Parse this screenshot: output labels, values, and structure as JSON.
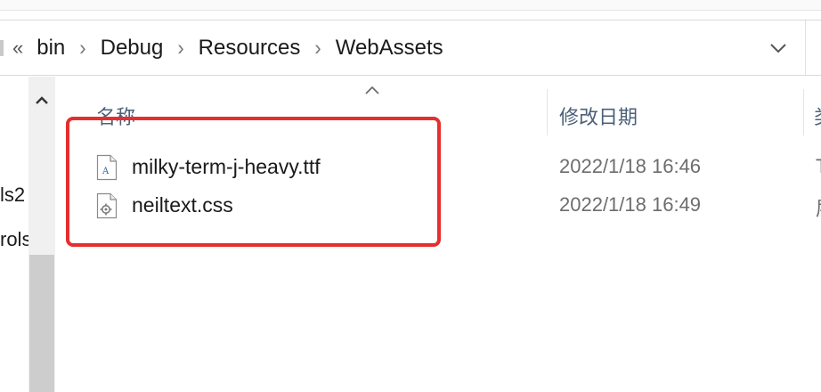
{
  "breadcrumb": {
    "overflow": "«",
    "items": [
      "bin",
      "Debug",
      "Resources",
      "WebAssets"
    ],
    "separator": "›"
  },
  "nav_pane": {
    "items": [
      "ls2",
      "rols"
    ]
  },
  "columns": {
    "name": "名称",
    "date_modified": "修改日期",
    "next_partial": "类"
  },
  "files": [
    {
      "name": "milky-term-j-heavy.ttf",
      "date": "2022/1/18 16:46",
      "type_partial": "T",
      "icon": "font-file-icon"
    },
    {
      "name": "neiltext.css",
      "date": "2022/1/18 16:49",
      "type_partial": "层",
      "icon": "css-file-icon"
    }
  ],
  "colors": {
    "highlight": "#e62e2e",
    "header_text": "#4c607a",
    "date_text": "#6d6d6d"
  }
}
